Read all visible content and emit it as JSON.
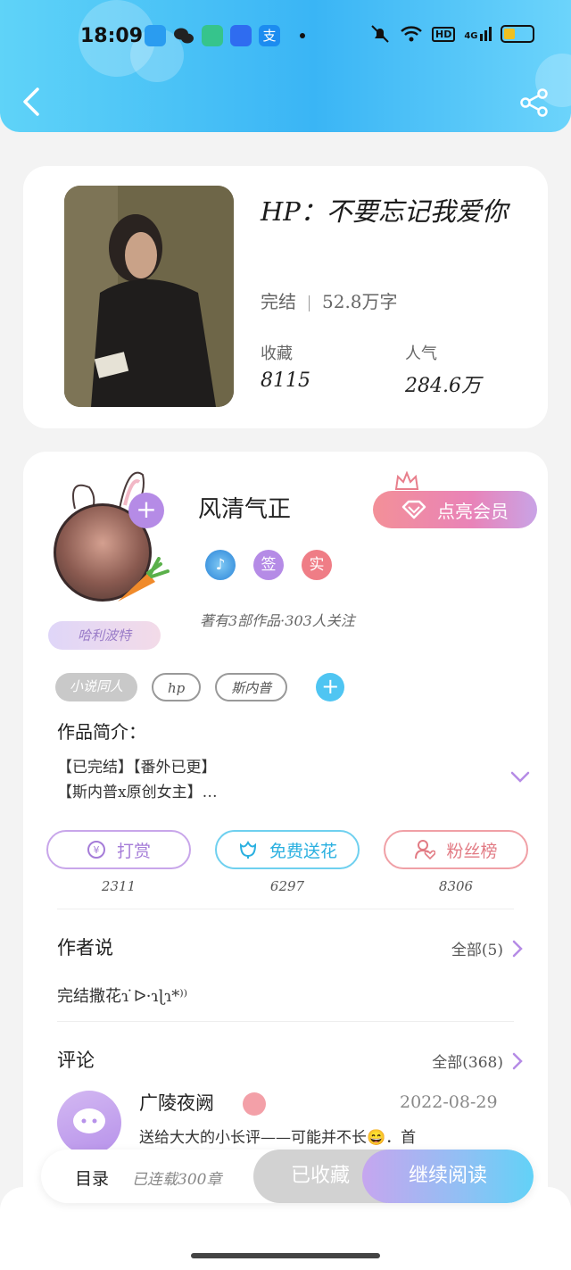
{
  "status_bar": {
    "time": "18:09",
    "network": "4G",
    "hd": "HD"
  },
  "header": {
    "back_icon": "chevron-left-icon",
    "share_icon": "share-icon"
  },
  "book": {
    "title": "HP：不要忘记我爱你",
    "status": "完结",
    "word_count": "52.8万字",
    "favorites_label": "收藏",
    "favorites_value": "8115",
    "popularity_label": "人气",
    "popularity_value": "284.6万"
  },
  "author": {
    "name": "风清气正",
    "vip_button": "点亮会员",
    "avatar_tag": "哈利波特",
    "badge_sign": "签",
    "badge_real": "实",
    "description": "著有3部作品·303人关注"
  },
  "tags": [
    "小说同人",
    "hp",
    "斯内普"
  ],
  "intro": {
    "title": "作品简介：",
    "line1": "【已完结】【番外已更】",
    "line2": "【斯内普x原创女主】…"
  },
  "actions": [
    {
      "label": "打赏",
      "count": "2311",
      "icon": "coin-icon"
    },
    {
      "label": "免费送花",
      "count": "6297",
      "icon": "flower-icon"
    },
    {
      "label": "粉丝榜",
      "count": "8306",
      "icon": "fan-icon"
    }
  ],
  "author_says": {
    "title": "作者说",
    "more": "全部(5)",
    "text": "完结撒花ɿ ̇ᐅ·ɿɭɿ*⁾⁾"
  },
  "comments": {
    "title": "评论",
    "more": "全部(368)",
    "first": {
      "name": "广陵夜阙",
      "date": "2022-08-29",
      "text": "送给大大的小长评——可能并不长😄．首"
    }
  },
  "bottom_bar": {
    "toc": "目录",
    "toc_sub": "已连载300章",
    "saved": "已收藏",
    "continue": "继续阅读"
  },
  "colors": {
    "header_gradient": [
      "#5fd3f8",
      "#3ab5f5"
    ],
    "vip_gradient": [
      "#f39098",
      "#c9a3e6"
    ],
    "reward": "#a57cd8",
    "flower": "#2ab0e0",
    "fans": "#e27b84"
  }
}
